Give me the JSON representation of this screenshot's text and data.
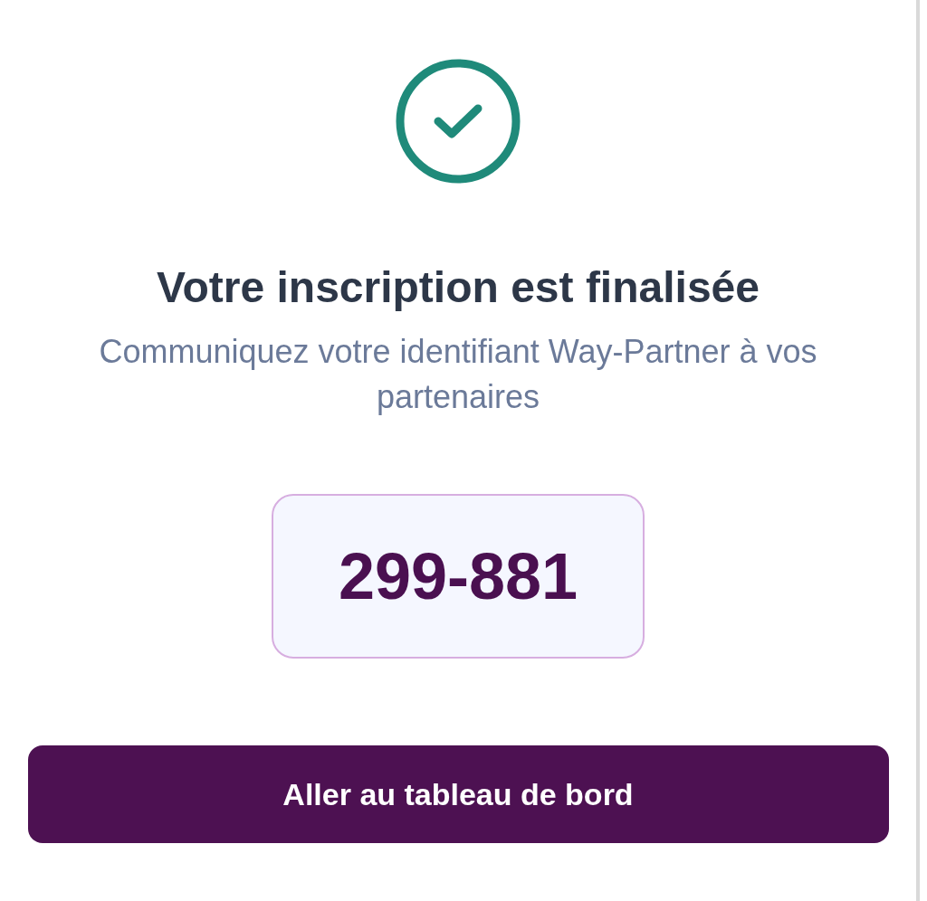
{
  "title": "Votre inscription est finalisée",
  "subtitle": "Communiquez votre identifiant Way-Partner à vos partenaires",
  "identifier": "299-881",
  "button": "Aller au tableau de bord"
}
